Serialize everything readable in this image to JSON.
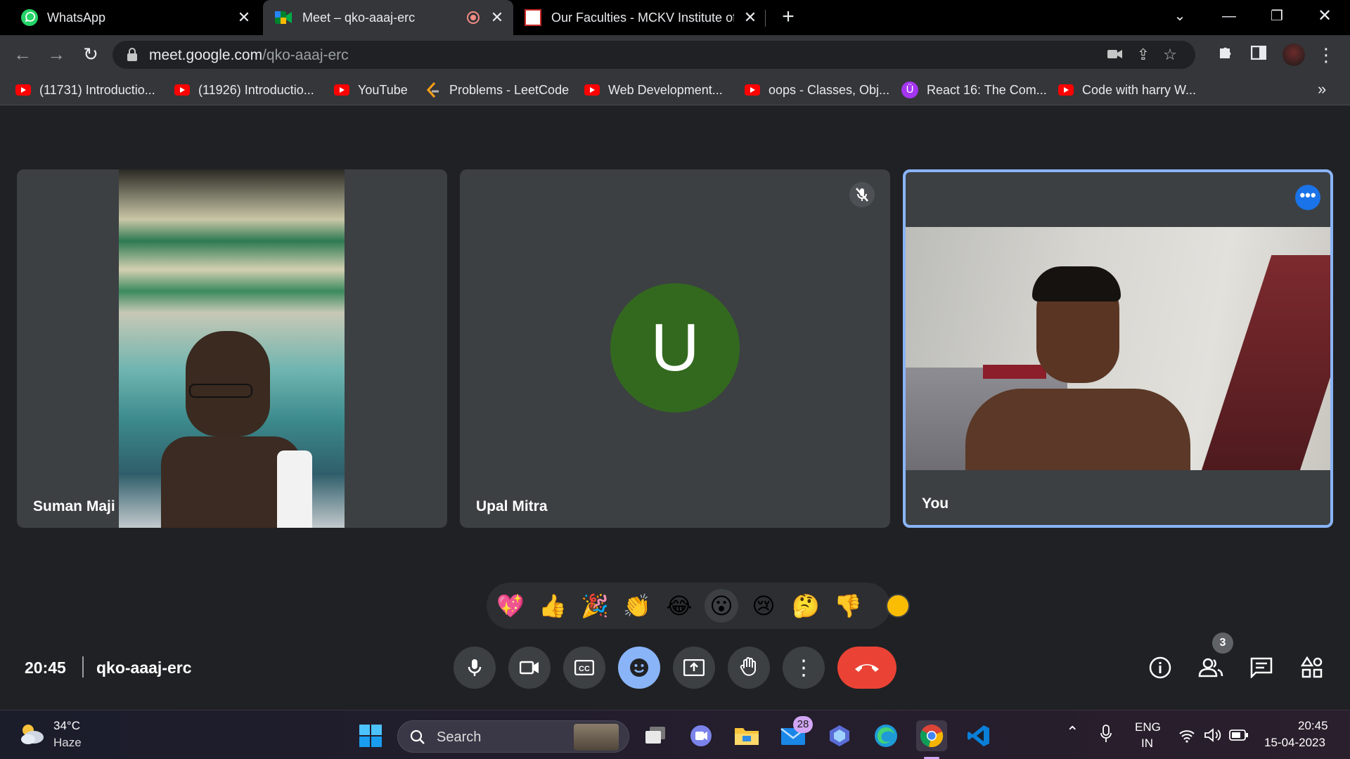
{
  "tabs": [
    {
      "title": "WhatsApp",
      "icon": "whatsapp-icon"
    },
    {
      "title": "Meet – qko-aaaj-erc",
      "icon": "google-meet-icon",
      "recording": true
    },
    {
      "title": "Our Faculties - MCKV Institute of",
      "icon": "mckv-icon"
    }
  ],
  "address": {
    "domain": "meet.google.com",
    "path": "/qko-aaaj-erc"
  },
  "bookmarks": [
    {
      "label": "(11731) Introductio...",
      "icon": "youtube-icon"
    },
    {
      "label": "(11926) Introductio...",
      "icon": "youtube-icon"
    },
    {
      "label": "YouTube",
      "icon": "youtube-icon"
    },
    {
      "label": "Problems - LeetCode",
      "icon": "leetcode-icon"
    },
    {
      "label": "Web Development...",
      "icon": "youtube-icon"
    },
    {
      "label": "oops - Classes, Obj...",
      "icon": "youtube-icon"
    },
    {
      "label": "React 16: The Com...",
      "icon": "udemy-icon"
    },
    {
      "label": "Code with harry  W...",
      "icon": "youtube-icon"
    }
  ],
  "participants": [
    {
      "name": "Suman Maji",
      "video": true
    },
    {
      "name": "Upal Mitra",
      "initial": "U",
      "muted": true,
      "avatar_color": "#33691e"
    },
    {
      "name": "You",
      "video": true,
      "active_speaker": true
    }
  ],
  "reactions": [
    "💖",
    "👍",
    "🎉",
    "👏",
    "😂",
    "😮",
    "😢",
    "🤔",
    "👎"
  ],
  "meeting": {
    "time": "20:45",
    "code": "qko-aaaj-erc"
  },
  "people_count": "3",
  "colors": {
    "accent": "#8ab4f8",
    "end_call": "#ea4335",
    "active_button": "#8ab4f8"
  },
  "taskbar": {
    "weather_temp": "34°C",
    "weather_desc": "Haze",
    "search_placeholder": "Search",
    "mail_badge": "28",
    "lang": "ENG",
    "region": "IN",
    "clock_time": "20:45",
    "clock_date": "15-04-2023"
  }
}
